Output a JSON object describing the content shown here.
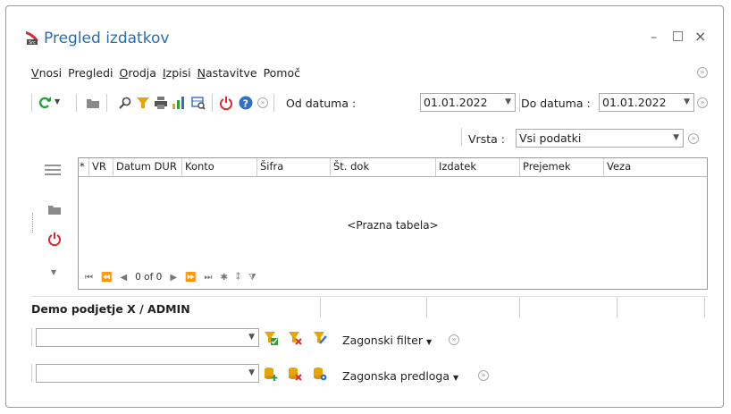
{
  "window": {
    "title": "Pregled izdatkov",
    "min_symbol": "–",
    "max_symbol": "□",
    "close_symbol": "×"
  },
  "menu": [
    {
      "label": "Vnosi",
      "ul": "V",
      "rest": "nosi"
    },
    {
      "label": "Pregledi",
      "ul": "",
      "rest": "Pregledi"
    },
    {
      "label": "Orodja",
      "ul": "O",
      "rest": "rodja"
    },
    {
      "label": "Izpisi",
      "ul": "I",
      "rest": "zpisi"
    },
    {
      "label": "Nastavitve",
      "ul": "N",
      "rest": "astavitve"
    },
    {
      "label": "Pomoč",
      "ul": "",
      "rest": "Pomoč"
    }
  ],
  "toolbar": {
    "icons": [
      "refresh-icon",
      "folder-icon",
      "search-icon",
      "filter-icon",
      "print-icon",
      "chart-icon",
      "grid-search-icon",
      "power-icon",
      "help-icon"
    ],
    "od_datuma_label": "Od datuma :",
    "od_datuma_value": "01.01.2022",
    "do_datuma_label": "Do datuma :",
    "do_datuma_value": "01.01.2022"
  },
  "vrsta": {
    "label": "Vrsta :",
    "value": "Vsi podatki"
  },
  "grid": {
    "columns": [
      "*",
      "VR",
      "Datum DUR",
      "Konto",
      "Šifra",
      "Št. dok",
      "Izdatek",
      "Prejemek",
      "Veza"
    ],
    "empty_text": "<Prazna tabela>",
    "pager": "0 of 0"
  },
  "status": {
    "company": "Demo podjetje X / ADMIN"
  },
  "filter": {
    "value": "",
    "label": "Zagonski filter"
  },
  "template": {
    "value": "",
    "label": "Zagonska predloga"
  },
  "colors": {
    "accent": "#2b6cb0",
    "refresh": "#2e9e3a",
    "filter": "#e8a400",
    "power": "#d62a2a",
    "help": "#2f6fd0"
  }
}
